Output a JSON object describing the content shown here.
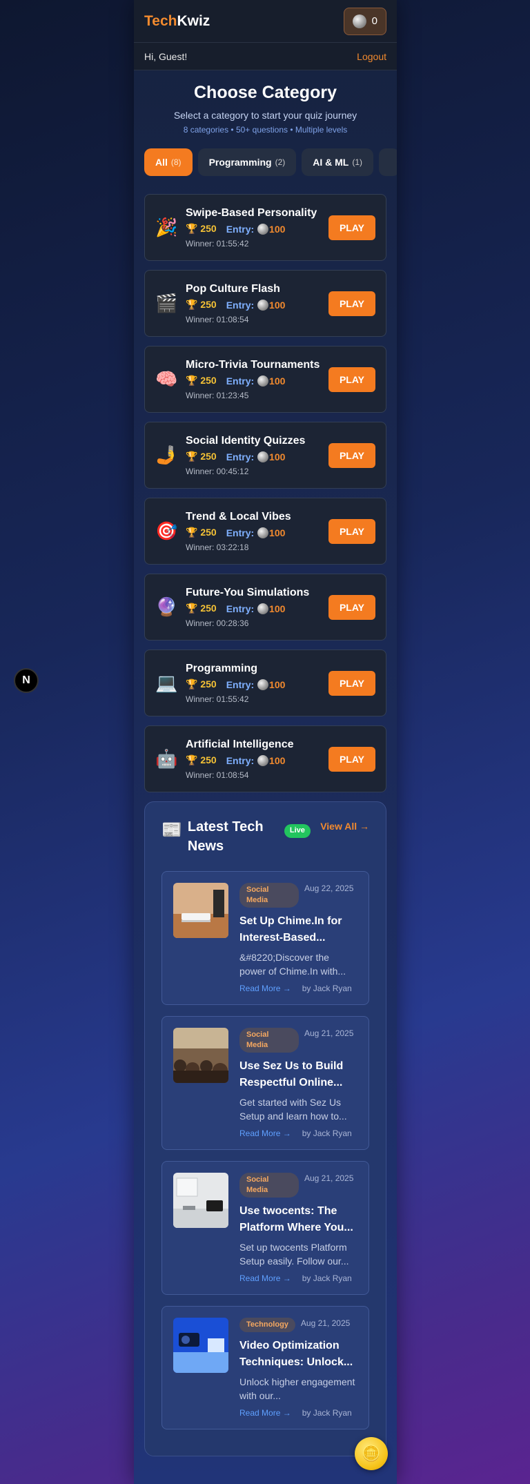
{
  "header": {
    "logo_part1": "Tech",
    "logo_part2": "Kwiz",
    "coins": "0"
  },
  "greeting": {
    "text": "Hi, Guest!",
    "logout": "Logout"
  },
  "page": {
    "title": "Choose Category",
    "subtitle": "Select a category to start your quiz journey",
    "meta": "8 categories • 50+ questions • Multiple levels"
  },
  "tabs": [
    {
      "label": "All",
      "count": "(8)",
      "active": true
    },
    {
      "label": "Programming",
      "count": "(2)",
      "active": false
    },
    {
      "label": "AI & ML",
      "count": "(1)",
      "active": false
    }
  ],
  "quiz_common": {
    "prize": "250",
    "entry_label": "Entry:",
    "entry": "100",
    "play": "PLAY"
  },
  "quizzes": [
    {
      "icon": "🎉",
      "name": "Swipe-Based Personality",
      "winner": "Winner: 01:55:42"
    },
    {
      "icon": "🎬",
      "name": "Pop Culture Flash",
      "winner": "Winner: 01:08:54"
    },
    {
      "icon": "🧠",
      "name": "Micro-Trivia Tournaments",
      "winner": "Winner: 01:23:45"
    },
    {
      "icon": "🤳",
      "name": "Social Identity Quizzes",
      "winner": "Winner: 00:45:12"
    },
    {
      "icon": "🎯",
      "name": "Trend & Local Vibes",
      "winner": "Winner: 03:22:18"
    },
    {
      "icon": "🔮",
      "name": "Future-You Simulations",
      "winner": "Winner: 00:28:36"
    },
    {
      "icon": "💻",
      "name": "Programming",
      "winner": "Winner: 01:55:42"
    },
    {
      "icon": "🤖",
      "name": "Artificial Intelligence",
      "winner": "Winner: 01:08:54"
    }
  ],
  "news": {
    "icon": "📰",
    "title": "Latest Tech News",
    "live": "Live",
    "view_all": "View All →",
    "read_more": "Read More →",
    "articles": [
      {
        "category": "Social Media",
        "date": "Aug 22, 2025",
        "title": "Set Up Chime.In for Interest-Based...",
        "desc": "&#8220;Discover the power of Chime.In with...",
        "author": "by Jack Ryan"
      },
      {
        "category": "Social Media",
        "date": "Aug 21, 2025",
        "title": "Use Sez Us to Build Respectful Online...",
        "desc": "Get started with Sez Us Setup and learn how to...",
        "author": "by Jack Ryan"
      },
      {
        "category": "Social Media",
        "date": "Aug 21, 2025",
        "title": "Use twocents: The Platform Where You...",
        "desc": "Set up twocents Platform Setup easily. Follow our...",
        "author": "by Jack Ryan"
      },
      {
        "category": "Technology",
        "date": "Aug 21, 2025",
        "title": "Video Optimization Techniques: Unlock...",
        "desc": "Unlock higher engagement with our...",
        "author": "by Jack Ryan"
      }
    ]
  },
  "misc": {
    "next_badge": "N",
    "coin_icon": "silver-coin-icon",
    "float_icon": "🪙"
  }
}
